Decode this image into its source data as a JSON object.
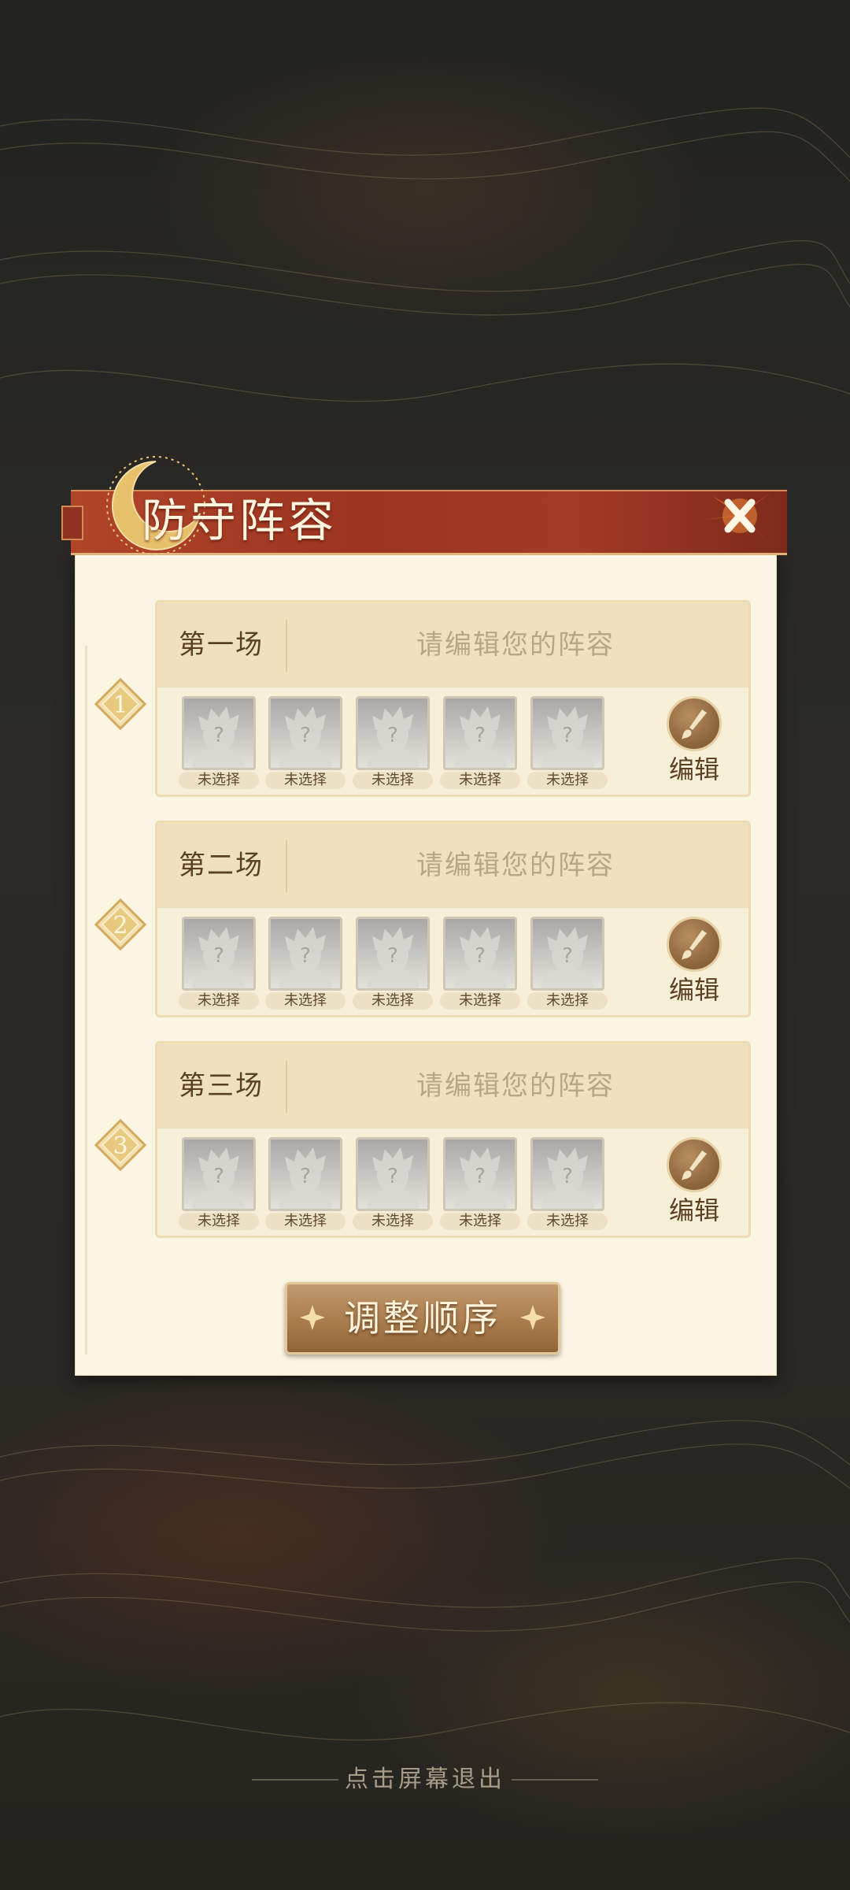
{
  "panel": {
    "title": "防守阵容",
    "close_icon": "close-x-icon"
  },
  "matches": [
    {
      "name": "第一场",
      "index": "1",
      "hint": "请编辑您的阵容",
      "slots": [
        "未选择",
        "未选择",
        "未选择",
        "未选择",
        "未选择"
      ],
      "edit_label": "编辑"
    },
    {
      "name": "第二场",
      "index": "2",
      "hint": "请编辑您的阵容",
      "slots": [
        "未选择",
        "未选择",
        "未选择",
        "未选择",
        "未选择"
      ],
      "edit_label": "编辑"
    },
    {
      "name": "第三场",
      "index": "3",
      "hint": "请编辑您的阵容",
      "slots": [
        "未选择",
        "未选择",
        "未选择",
        "未选择",
        "未选择"
      ],
      "edit_label": "编辑"
    }
  ],
  "order_button_label": "调整顺序",
  "exit_hint": "点击屏幕退出",
  "colors": {
    "ribbon": "#9c3420",
    "panel_bg": "#fbf5e4",
    "gold": "#d9b56a",
    "edit_button": "#8a6238"
  }
}
